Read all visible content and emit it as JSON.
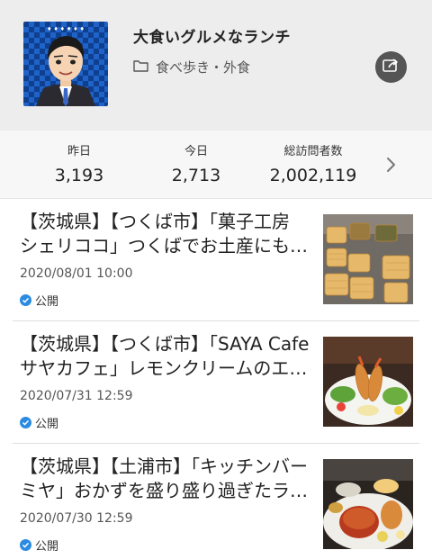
{
  "header": {
    "blog_title": "大食いグルメなランチ",
    "category": "食べ歩き・外食",
    "avatar_icon": "user-avatar",
    "category_icon": "folder-icon",
    "share_icon": "share-icon"
  },
  "stats": {
    "items": [
      {
        "label": "昨日",
        "value": "3,193"
      },
      {
        "label": "今日",
        "value": "2,713"
      },
      {
        "label": "総訪問者数",
        "value": "2,002,119"
      }
    ],
    "more_icon": "chevron-right-icon"
  },
  "posts": [
    {
      "title": "【茨城県】【つくば市】「菓子工房 シェリココ」つくばでお土産にも喜ばれるワッフル",
      "date": "2020/08/01 10:00",
      "status": "公開"
    },
    {
      "title": "【茨城県】【つくば市】「SAYA Cafe サヤカフェ」レモンクリームのエビフライ",
      "date": "2020/07/31 12:59",
      "status": "公開"
    },
    {
      "title": "【茨城県】【土浦市】「キッチンバー ミヤ」おかずを盛り盛り過ぎたランチ",
      "date": "2020/07/30 12:59",
      "status": "公開"
    }
  ],
  "colors": {
    "header_bg": "#ededed",
    "check_blue": "#2b8be0",
    "avatar_blue": "#1f62c8"
  }
}
